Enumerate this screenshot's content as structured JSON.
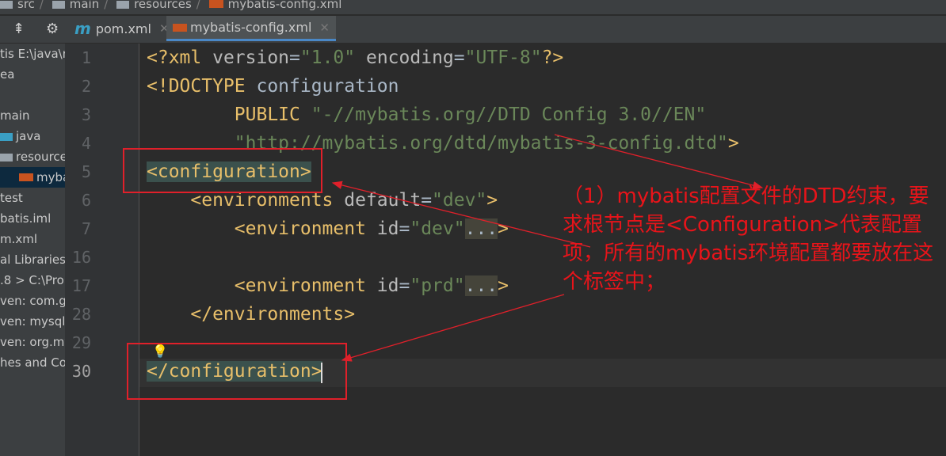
{
  "breadcrumb": [
    "src",
    "main",
    "resources",
    "mybatis-config.xml"
  ],
  "tabs": [
    {
      "label": "pom.xml",
      "icon": "maven-icon"
    },
    {
      "label": "mybatis-config.xml",
      "icon": "xml-file-icon",
      "active": true
    }
  ],
  "sidebar": {
    "items": [
      "tis  E:\\java\\m",
      "ea",
      "",
      "main",
      "java",
      "resource",
      "myba",
      "test",
      "batis.iml",
      "m.xml",
      "al Libraries",
      ".8 >  C:\\Pro",
      "ven: com.g",
      "ven: mysql:",
      "ven: org.my",
      "hes and Co"
    ]
  },
  "line_numbers": [
    "1",
    "2",
    "3",
    "4",
    "5",
    "6",
    "7",
    "16",
    "17",
    "28",
    "29",
    "30"
  ],
  "code": [
    [
      {
        "t": "<?xml ",
        "c": "tg"
      },
      {
        "t": "version",
        "c": "at"
      },
      {
        "t": "=",
        "c": "pl"
      },
      {
        "t": "\"1.0\" ",
        "c": "st"
      },
      {
        "t": "encoding",
        "c": "at"
      },
      {
        "t": "=",
        "c": "pl"
      },
      {
        "t": "\"UTF-8\"",
        "c": "st"
      },
      {
        "t": "?>",
        "c": "tg"
      }
    ],
    [
      {
        "t": "<!DOCTYPE ",
        "c": "tg"
      },
      {
        "t": "configuration",
        "c": "pl"
      }
    ],
    [
      {
        "t": "        PUBLIC ",
        "c": "kw"
      },
      {
        "t": "\"-//mybatis.org//DTD Config 3.0//EN\"",
        "c": "st"
      }
    ],
    [
      {
        "t": "        \"http://mybatis.org/dtd/mybatis-3-config.dtd\"",
        "c": "st"
      },
      {
        "t": ">",
        "c": "tg"
      }
    ],
    [
      {
        "t": "<configuration>",
        "c": "tg hl"
      }
    ],
    [
      {
        "t": "    <environments ",
        "c": "tg"
      },
      {
        "t": "default",
        "c": "at"
      },
      {
        "t": "=",
        "c": "pl"
      },
      {
        "t": "\"dev\"",
        "c": "st"
      },
      {
        "t": ">",
        "c": "tg"
      }
    ],
    [
      {
        "t": "        <environment ",
        "c": "tg"
      },
      {
        "t": "id",
        "c": "at"
      },
      {
        "t": "=",
        "c": "pl"
      },
      {
        "t": "\"dev\"",
        "c": "st"
      },
      {
        "t": "...",
        "c": "dots"
      },
      {
        "t": ">",
        "c": "tg"
      }
    ],
    [],
    [
      {
        "t": "        <environment ",
        "c": "tg"
      },
      {
        "t": "id",
        "c": "at"
      },
      {
        "t": "=",
        "c": "pl"
      },
      {
        "t": "\"prd\"",
        "c": "st"
      },
      {
        "t": "...",
        "c": "dots"
      },
      {
        "t": ">",
        "c": "tg"
      }
    ],
    [
      {
        "t": "    </environments>",
        "c": "tg"
      }
    ],
    [],
    [
      {
        "t": "</configuration>",
        "c": "tg hl"
      }
    ]
  ],
  "annotation": "（1）mybatis配置文件的DTD约束，要求根节点是<Configuration>代表配置项，所有的mybatis环境配置都要放在这个标签中；",
  "colors": {
    "annotation": "#e8141a",
    "editor_bg": "#2b2b2b"
  }
}
